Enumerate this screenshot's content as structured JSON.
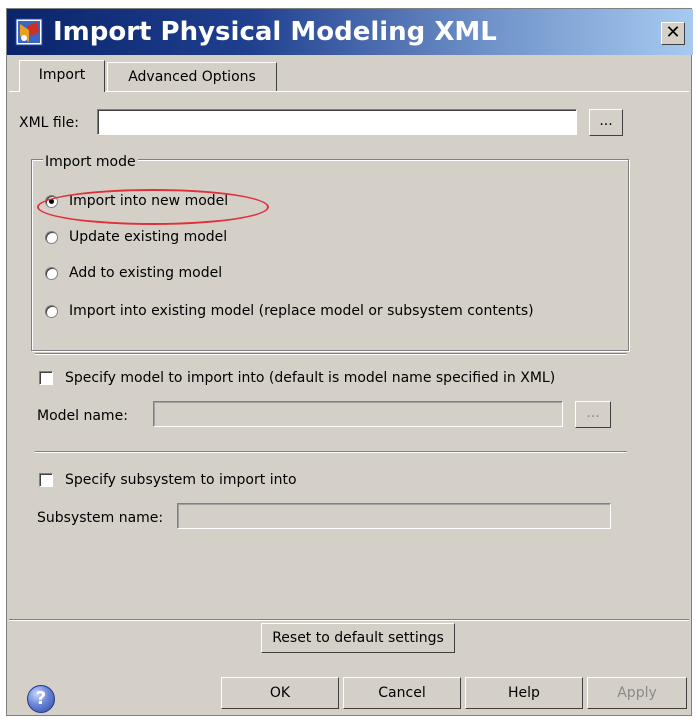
{
  "window": {
    "title": "Import Physical Modeling XML",
    "close_glyph": "✕"
  },
  "tabs": [
    {
      "label": "Import",
      "selected": true
    },
    {
      "label": "Advanced Options",
      "selected": false
    }
  ],
  "xml_file": {
    "label": "XML file:",
    "value": "",
    "browse_label": "..."
  },
  "import_mode": {
    "legend": "Import mode",
    "options": [
      {
        "label": "Import into new model",
        "selected": true
      },
      {
        "label": "Update existing model",
        "selected": false
      },
      {
        "label": "Add to existing model",
        "selected": false
      },
      {
        "label": "Import into existing model (replace model or subsystem contents)",
        "selected": false
      }
    ],
    "highlight_color": "#e0303a"
  },
  "model": {
    "checkbox_label": "Specify model to import into (default is model name specified in XML)",
    "checked": false,
    "name_label": "Model name:",
    "name_value": "",
    "browse_label": "..."
  },
  "subsystem": {
    "checkbox_label": "Specify subsystem to import into",
    "checked": false,
    "name_label": "Subsystem name:",
    "name_value": ""
  },
  "buttons": {
    "reset": "Reset to default settings",
    "ok": "OK",
    "cancel": "Cancel",
    "help": "Help",
    "apply": "Apply",
    "help_icon_glyph": "?"
  },
  "icons": {
    "app": "simulink-icon",
    "help": "help-icon"
  }
}
